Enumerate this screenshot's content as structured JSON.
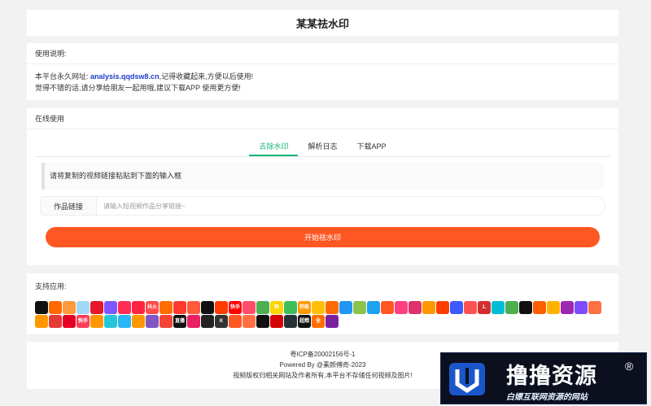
{
  "page": {
    "title": "某某祛水印"
  },
  "usage": {
    "heading": "使用说明:",
    "line1_prefix": "本平台永久网址:",
    "url": "analysis.qqdsw8.cn",
    "line1_suffix": ",记得收藏起来,方便以后使用!",
    "line2": "觉得不错的话,请分享给朋友一起用哦,建议下载APP 使用更方便!"
  },
  "online": {
    "heading": "在线使用",
    "tabs": [
      {
        "label": "去除水印",
        "active": true
      },
      {
        "label": "解析日志",
        "active": false
      },
      {
        "label": "下载APP",
        "active": false
      }
    ],
    "tip": "请将复制的视频链接粘贴到下面的输入框",
    "field_label": "作品链接",
    "input_placeholder": "请输入短视频作品分享链接~",
    "input_value": "",
    "start_button": "开始祛水印"
  },
  "apps": {
    "heading": "支持应用:",
    "icons": [
      {
        "name": "douyin-icon",
        "color": "#111111",
        "text": ""
      },
      {
        "name": "kuaishou-icon",
        "color": "#ff6a00",
        "text": ""
      },
      {
        "name": "weishi-icon",
        "color": "#ff9a3c",
        "text": ""
      },
      {
        "name": "lvzhou-icon",
        "color": "#9fd9f6",
        "text": ""
      },
      {
        "name": "weibo-icon",
        "color": "#e6162d",
        "text": ""
      },
      {
        "name": "pipixia-icon",
        "color": "#7e57ff",
        "text": ""
      },
      {
        "name": "zuiyou-icon",
        "color": "#ff2d55",
        "text": ""
      },
      {
        "name": "xiaohongshu-icon",
        "color": "#ff2442",
        "text": ""
      },
      {
        "name": "huoshan-icon",
        "color": "#ff4a4a",
        "text": "抖火"
      },
      {
        "name": "momo-icon",
        "color": "#ff6d00",
        "text": ""
      },
      {
        "name": "haokan-icon",
        "color": "#ff3b2f",
        "text": ""
      },
      {
        "name": "xigua-icon",
        "color": "#ff5a3a",
        "text": ""
      },
      {
        "name": "capcut-icon",
        "color": "#111111",
        "text": ""
      },
      {
        "name": "video-icon",
        "color": "#ff3c00",
        "text": ""
      },
      {
        "name": "youtube-icon",
        "color": "#ff0000",
        "text": "快手"
      },
      {
        "name": "meipai-icon",
        "color": "#ff4d6a",
        "text": ""
      },
      {
        "name": "weishi-green-icon",
        "color": "#4caf50",
        "text": ""
      },
      {
        "name": "kuaikan-icon",
        "color": "#ffd400",
        "text": "快"
      },
      {
        "name": "wanpi-icon",
        "color": "#3fbf5c",
        "text": ""
      },
      {
        "name": "jiqing-icon",
        "color": "#ff9800",
        "text": "积极"
      },
      {
        "name": "chick-icon",
        "color": "#ffc107",
        "text": ""
      },
      {
        "name": "play-icon",
        "color": "#ff6a00",
        "text": ""
      },
      {
        "name": "duoduo-icon",
        "color": "#2196f3",
        "text": ""
      },
      {
        "name": "chart-icon",
        "color": "#8bc34a",
        "text": ""
      },
      {
        "name": "twitter-icon",
        "color": "#1da1f2",
        "text": ""
      },
      {
        "name": "fire-icon",
        "color": "#ff5722",
        "text": ""
      },
      {
        "name": "camera-icon",
        "color": "#ff4081",
        "text": ""
      },
      {
        "name": "instagram-icon",
        "color": "#e1306c",
        "text": ""
      },
      {
        "name": "face-icon",
        "color": "#ff9800",
        "text": ""
      },
      {
        "name": "avatar-icon",
        "color": "#ff3d00",
        "text": ""
      },
      {
        "name": "doc-icon",
        "color": "#3d5afe",
        "text": ""
      },
      {
        "name": "lens-icon",
        "color": "#ff5252",
        "text": ""
      },
      {
        "name": "one-icon",
        "color": "#d32f2f",
        "text": "1."
      },
      {
        "name": "circle-play-icon",
        "color": "#00bcd4",
        "text": ""
      },
      {
        "name": "eye-icon",
        "color": "#4caf50",
        "text": ""
      },
      {
        "name": "tiktok-icon",
        "color": "#111111",
        "text": ""
      },
      {
        "name": "youku-icon",
        "color": "#ff5e00",
        "text": ""
      },
      {
        "name": "flower-icon",
        "color": "#ffb300",
        "text": ""
      },
      {
        "name": "dots-icon",
        "color": "#9c27b0",
        "text": ""
      },
      {
        "name": "soul-icon",
        "color": "#7c4dff",
        "text": ""
      },
      {
        "name": "shield-icon",
        "color": "#ff7043",
        "text": ""
      },
      {
        "name": "person-icon",
        "color": "#ff9800",
        "text": ""
      },
      {
        "name": "panda-icon",
        "color": "#e53935",
        "text": ""
      },
      {
        "name": "netease-icon",
        "color": "#e60026",
        "text": ""
      },
      {
        "name": "kuaishou-red-icon",
        "color": "#ff3d57",
        "text": "快手"
      },
      {
        "name": "cat-icon",
        "color": "#ff9800",
        "text": ""
      },
      {
        "name": "bird-icon",
        "color": "#26c6da",
        "text": ""
      },
      {
        "name": "ghost-icon",
        "color": "#29b6f6",
        "text": ""
      },
      {
        "name": "fox-icon",
        "color": "#ff9800",
        "text": ""
      },
      {
        "name": "purple-icon",
        "color": "#7e57c2",
        "text": ""
      },
      {
        "name": "red-dot-icon",
        "color": "#f44336",
        "text": ""
      },
      {
        "name": "live-icon",
        "color": "#111111",
        "text": "直播"
      },
      {
        "name": "red-square-icon",
        "color": "#e91e63",
        "text": ""
      },
      {
        "name": "bilibili-icon",
        "color": "#222222",
        "text": ""
      },
      {
        "name": "k-icon",
        "color": "#333333",
        "text": "K"
      },
      {
        "name": "ring-icon",
        "color": "#ff5722",
        "text": ""
      },
      {
        "name": "ball-icon",
        "color": "#ff7043",
        "text": ""
      },
      {
        "name": "film-icon",
        "color": "#111111",
        "text": ""
      },
      {
        "name": "mask-icon",
        "color": "#d50000",
        "text": ""
      },
      {
        "name": "screen-icon",
        "color": "#263238",
        "text": ""
      },
      {
        "name": "bold-icon",
        "color": "#111111",
        "text": "超燃"
      },
      {
        "name": "quan-icon",
        "color": "#ff6f00",
        "text": "全"
      },
      {
        "name": "o-icon",
        "color": "#7b1fa2",
        "text": ""
      }
    ]
  },
  "footer": {
    "icp": "粤ICP备20002156号-1",
    "powered": "Powered By @素颜傅奇-2023",
    "copyright": "视频版权归相关网站及作者所有,本平台不存储任何视频及图片!"
  },
  "logo": {
    "title": "撸撸资源",
    "reg": "®",
    "subtitle": "白嫖互联网资源的网站",
    "colors": {
      "blue": "#1a56c9",
      "bg": "#0b0f1e"
    }
  }
}
